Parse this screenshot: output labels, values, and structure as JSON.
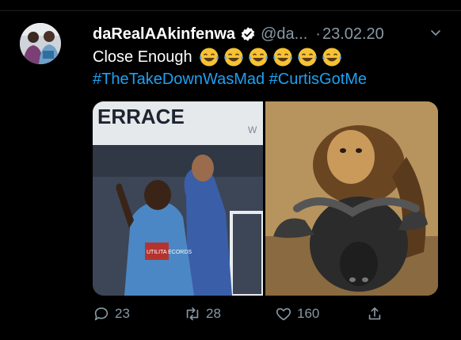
{
  "tweet": {
    "display_name": "daRealAAkinfenwa",
    "handle": "@da...",
    "separator": "·",
    "date": "23.02.20",
    "text_line1": "Close Enough",
    "hashtags": "#TheTakeDownWasMad #CurtisGotMe",
    "emojis": [
      "laughing-with-tears",
      "laughing-with-tears",
      "laughing-with-tears",
      "laughing-with-tears",
      "laughing-with-tears",
      "laughing-with-tears"
    ]
  },
  "media": {
    "left_sign_text": "ERRACE",
    "left_sign_text_2": "W",
    "shirt_text": "UTILITA ECORDS"
  },
  "actions": {
    "replies": "23",
    "retweets": "28",
    "likes": "160"
  },
  "colors": {
    "background": "#000000",
    "link": "#1da1f2",
    "muted": "#8899a6",
    "verified": "#ffffff"
  }
}
